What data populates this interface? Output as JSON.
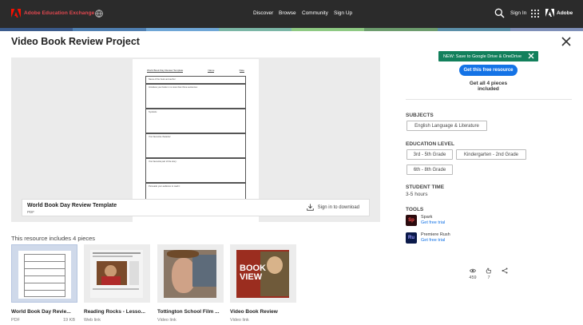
{
  "header": {
    "brand": "Adobe Education Exchange",
    "nav": [
      "Discover",
      "Browse",
      "Community",
      "Sign Up"
    ],
    "sign_in": "Sign In",
    "adobe": "Adobe"
  },
  "strip_colors": [
    "#3b5b8c",
    "#4f7fb1",
    "#6fa6d6",
    "#7bb6a6",
    "#8ec983",
    "#6d9c6e",
    "#5b8fa8",
    "#7e8fb8"
  ],
  "title": "Video Book Review Project",
  "preview": {
    "doc_title": "World Book Day Review Template",
    "doc_name": "Name",
    "doc_date": "Date",
    "rows": [
      "Name of the book and author:",
      "Introduce your book in no more than three sentences:",
      "Symbols:",
      "Your favourite character:",
      "Your favourite part of the story:",
      "Persuade your audience to read it:"
    ],
    "file_title": "World Book Day Review Template",
    "file_type": "PDF",
    "download": "Sign in to download"
  },
  "includes_label": "This resource includes 4 pieces",
  "pieces": [
    {
      "name": "World Book Day Revie...",
      "type": "PDF",
      "size": "19 KB"
    },
    {
      "name": "Reading Rocks - Lesso...",
      "type": "Web link",
      "size": ""
    },
    {
      "name": "Tottington School Film ...",
      "type": "Video link",
      "size": ""
    },
    {
      "name": "Video Book Review",
      "type": "Video link",
      "size": ""
    }
  ],
  "aside": {
    "badge": "NEW: Save to Google Drive & OneDrive",
    "get_button": "Get this free resource",
    "all_pieces": "Get all 4 pieces included",
    "subjects_h": "SUBJECTS",
    "subjects": [
      "English Language & Literature"
    ],
    "edu_h": "EDUCATION LEVEL",
    "levels": [
      "3rd - 5th Grade",
      "Kindergarten - 2nd Grade",
      "6th - 8th Grade"
    ],
    "time_h": "STUDENT TIME",
    "time": "3-5 hours",
    "tools_h": "TOOLS",
    "tools": [
      {
        "abbr": "Sp",
        "name": "Spark",
        "trial": "Get free trial",
        "bg": "#2b0b0e",
        "fg": "#ff4f4f"
      },
      {
        "abbr": "Ru",
        "name": "Premiere Rush",
        "trial": "Get free trial",
        "bg": "#0b1a4a",
        "fg": "#9999ff"
      }
    ],
    "stats": {
      "views": "459",
      "favorites": "7",
      "share": ""
    }
  }
}
